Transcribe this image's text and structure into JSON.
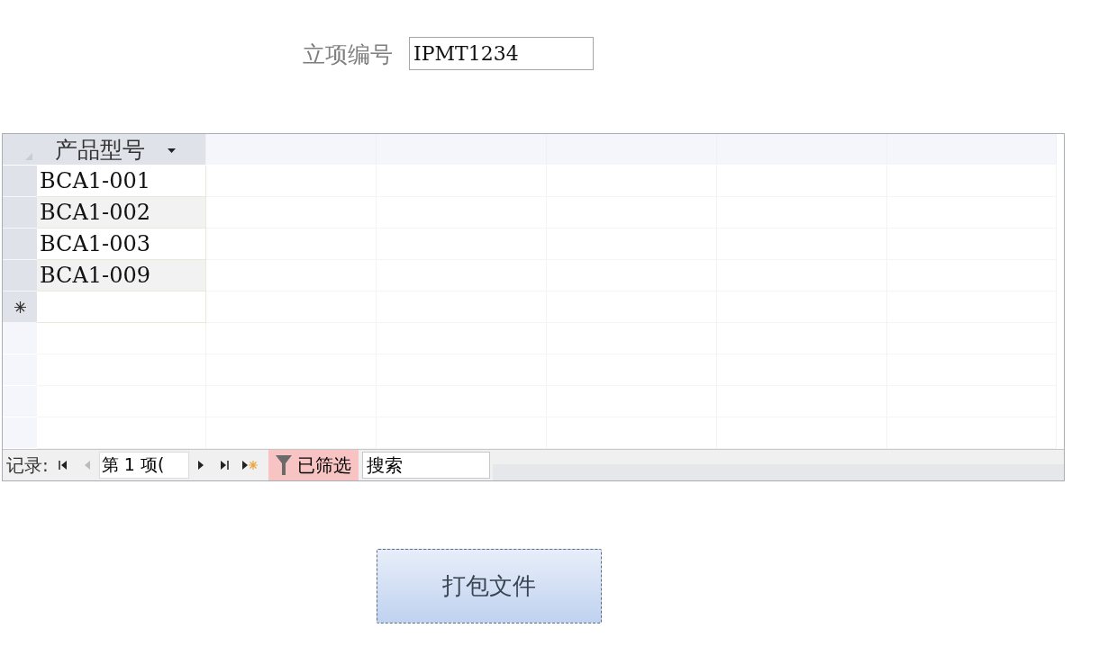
{
  "project_field": {
    "label": "立项编号",
    "value": "IPMT1234"
  },
  "datasheet": {
    "columns": [
      {
        "label": "产品型号"
      }
    ],
    "rows": [
      {
        "cell": "BCA1-001"
      },
      {
        "cell": "BCA1-002"
      },
      {
        "cell": "BCA1-003"
      },
      {
        "cell": "BCA1-009"
      }
    ],
    "navigation": {
      "label": "记录:",
      "position": "第 1 项(",
      "buttons": [
        {
          "kind": "first",
          "disabled": false
        },
        {
          "kind": "prev",
          "disabled": true
        },
        {
          "kind": "next",
          "disabled": false
        },
        {
          "kind": "last",
          "disabled": false
        },
        {
          "kind": "new",
          "disabled": false
        }
      ],
      "filter": {
        "label": "已筛选",
        "on": true
      },
      "search": {
        "placeholder": "搜索"
      }
    }
  },
  "buttons": [
    {
      "label": "打包文件"
    }
  ]
}
